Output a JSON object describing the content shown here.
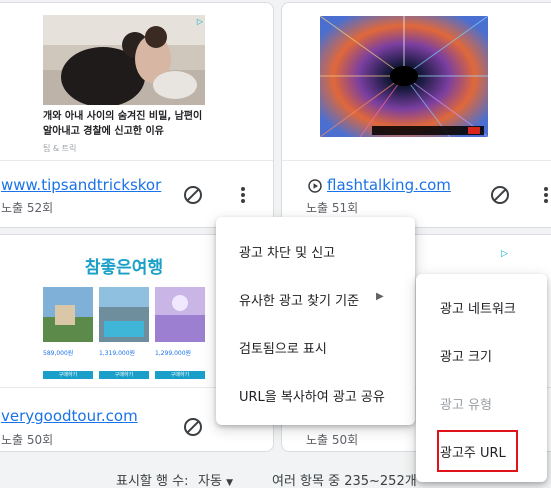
{
  "cards": [
    {
      "ad_headline": "개와 아내 사이의 숨겨진 비밀, 남편이 알아내고 경찰에 신고한 이유",
      "ad_source": "팁 & 트릭",
      "domain": "www.tipsandtrickskor",
      "impressions": "노출 52회"
    },
    {
      "domain": "flashtalking.com",
      "impressions": "노출 51회"
    },
    {
      "ad_brand": "참좋은여행",
      "ad_prices": [
        "589,000원",
        "1,319,000원",
        "1,299,000원"
      ],
      "ad_cta": "구매하기",
      "domain": "verygoodtour.com",
      "impressions": "노출 50회"
    },
    {
      "impressions": "노출 50회"
    }
  ],
  "context_menu": {
    "items": [
      "광고 차단 및 신고",
      "유사한 광고 찾기 기준",
      "검토됨으로 표시",
      "URL을 복사하여 광고 공유"
    ]
  },
  "submenu": {
    "items": [
      "광고 네트워크",
      "광고 크기",
      "광고 유형",
      "광고주 URL"
    ]
  },
  "footer": {
    "rows_label": "표시할 행 수:",
    "rows_value": "자동",
    "range": "여러 항목 중 235~252개"
  },
  "colors": {
    "link": "#1a73e8",
    "highlight": "#e1121a"
  }
}
